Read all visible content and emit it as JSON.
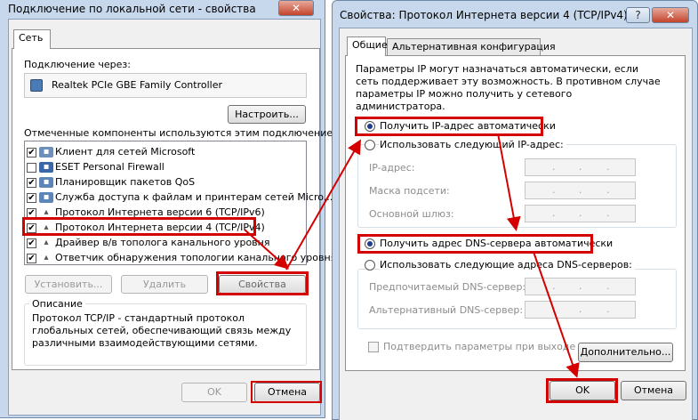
{
  "left_window": {
    "title": "Подключение по локальной сети - свойства",
    "tab": "Сеть",
    "connect_via_label": "Подключение через:",
    "adapter_name": "Realtek PCIe GBE Family Controller",
    "configure_button": "Настроить...",
    "components_label": "Отмеченные компоненты используются этим подключением:",
    "components": [
      {
        "label": "Клиент для сетей Microsoft",
        "checked": true,
        "icon": "network-client-icon"
      },
      {
        "label": "ESET Personal Firewall",
        "checked": false,
        "icon": "firewall-icon"
      },
      {
        "label": "Планировщик пакетов QoS",
        "checked": true,
        "icon": "qos-icon"
      },
      {
        "label": "Служба доступа к файлам и принтерам сетей Micro...",
        "checked": true,
        "icon": "file-share-icon"
      },
      {
        "label": "Протокол Интернета версии 6 (TCP/IPv6)",
        "checked": true,
        "icon": "protocol-icon"
      },
      {
        "label": "Протокол Интернета версии 4 (TCP/IPv4)",
        "checked": true,
        "icon": "protocol-icon"
      },
      {
        "label": "Драйвер в/в тополога канального уровня",
        "checked": true,
        "icon": "protocol-icon"
      },
      {
        "label": "Ответчик обнаружения топологии канального уровня",
        "checked": true,
        "icon": "protocol-icon"
      }
    ],
    "install_button": "Установить...",
    "remove_button": "Удалить",
    "properties_button": "Свойства",
    "description_title": "Описание",
    "description_text": "Протокол TCP/IP - стандартный протокол глобальных сетей, обеспечивающий связь между различными взаимодействующими сетями.",
    "ok_button": "OK",
    "cancel_button": "Отмена",
    "close_glyph": "✕"
  },
  "right_window": {
    "title": "Свойства: Протокол Интернета версии 4 (TCP/IPv4)",
    "help_glyph": "?",
    "close_glyph": "✕",
    "tabs": [
      "Общие",
      "Альтернативная конфигурация"
    ],
    "info_text": "Параметры IP могут назначаться автоматически, если сеть поддерживает эту возможность. В противном случае параметры IP можно получить у сетевого администратора.",
    "radio_auto_ip": "Получить IP-адрес автоматически",
    "radio_manual_ip": "Использовать следующий IP-адрес:",
    "ip_label": "IP-адрес:",
    "mask_label": "Маска подсети:",
    "gateway_label": "Основной шлюз:",
    "radio_auto_dns": "Получить адрес DNS-сервера автоматически",
    "radio_manual_dns": "Использовать следующие адреса DNS-серверов:",
    "preferred_dns_label": "Предпочитаемый DNS-сервер:",
    "alternate_dns_label": "Альтернативный DNS-сервер:",
    "ip_placeholder": ".   .   .",
    "validate_label": "Подтвердить параметры при выходе",
    "advanced_button": "Дополнительно...",
    "ok_button": "OK",
    "cancel_button": "Отмена"
  },
  "colors": {
    "highlight": "#d40000",
    "titlebar": "#c7d8ec"
  }
}
